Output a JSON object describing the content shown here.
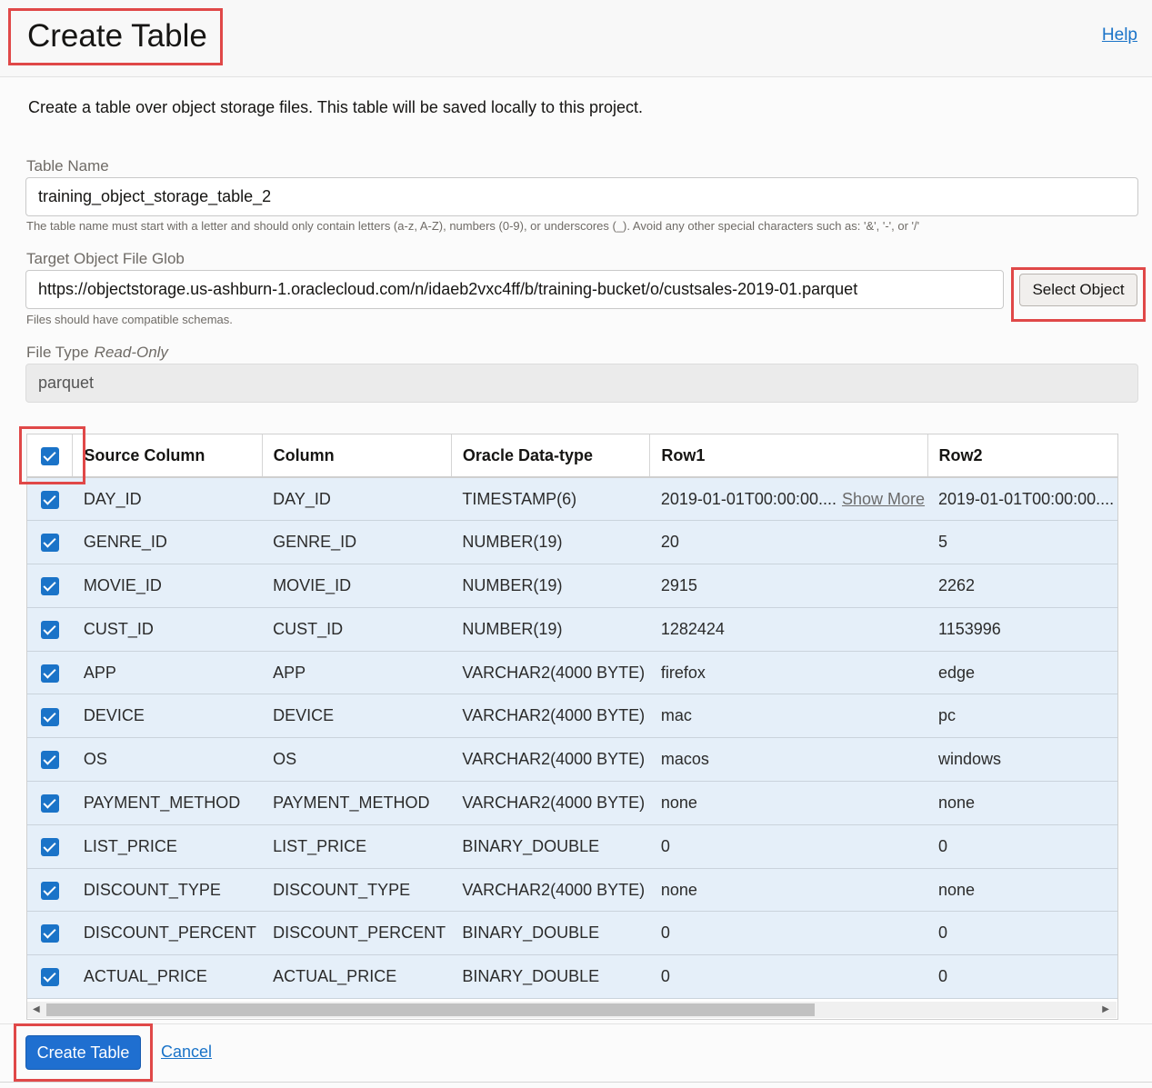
{
  "header": {
    "title": "Create Table",
    "help_link": "Help"
  },
  "description": "Create a table over object storage files. This table will be saved locally to this project.",
  "form": {
    "table_name_label": "Table Name",
    "table_name_value": "training_object_storage_table_2",
    "table_name_hint": "The table name must start with a letter and should only contain letters (a-z, A-Z), numbers (0-9), or underscores (_). Avoid any other special characters such as: '&', '-', or '/'",
    "glob_label": "Target Object File Glob",
    "glob_value": "https://objectstorage.us-ashburn-1.oraclecloud.com/n/idaeb2vxc4ff/b/training-bucket/o/custsales-2019-01.parquet",
    "glob_hint": "Files should have compatible schemas.",
    "select_object_button": "Select Object",
    "file_type_label": "File Type",
    "file_type_readonly": "Read-Only",
    "file_type_value": "parquet"
  },
  "table": {
    "headers": [
      "Source Column",
      "Column",
      "Oracle Data-type",
      "Row1",
      "Row2"
    ],
    "show_more": "Show More",
    "rows": [
      {
        "source": "DAY_ID",
        "column": "DAY_ID",
        "type": "TIMESTAMP(6)",
        "row1": "2019-01-01T00:00:00....",
        "row2": "2019-01-01T00:00:00...."
      },
      {
        "source": "GENRE_ID",
        "column": "GENRE_ID",
        "type": "NUMBER(19)",
        "row1": "20",
        "row2": "5"
      },
      {
        "source": "MOVIE_ID",
        "column": "MOVIE_ID",
        "type": "NUMBER(19)",
        "row1": "2915",
        "row2": "2262"
      },
      {
        "source": "CUST_ID",
        "column": "CUST_ID",
        "type": "NUMBER(19)",
        "row1": "1282424",
        "row2": "1153996"
      },
      {
        "source": "APP",
        "column": "APP",
        "type": "VARCHAR2(4000 BYTE)",
        "row1": "firefox",
        "row2": "edge"
      },
      {
        "source": "DEVICE",
        "column": "DEVICE",
        "type": "VARCHAR2(4000 BYTE)",
        "row1": "mac",
        "row2": "pc"
      },
      {
        "source": "OS",
        "column": "OS",
        "type": "VARCHAR2(4000 BYTE)",
        "row1": "macos",
        "row2": "windows"
      },
      {
        "source": "PAYMENT_METHOD",
        "column": "PAYMENT_METHOD",
        "type": "VARCHAR2(4000 BYTE)",
        "row1": "none",
        "row2": "none"
      },
      {
        "source": "LIST_PRICE",
        "column": "LIST_PRICE",
        "type": "BINARY_DOUBLE",
        "row1": "0",
        "row2": "0"
      },
      {
        "source": "DISCOUNT_TYPE",
        "column": "DISCOUNT_TYPE",
        "type": "VARCHAR2(4000 BYTE)",
        "row1": "none",
        "row2": "none"
      },
      {
        "source": "DISCOUNT_PERCENT",
        "column": "DISCOUNT_PERCENT",
        "type": "BINARY_DOUBLE",
        "row1": "0",
        "row2": "0"
      },
      {
        "source": "ACTUAL_PRICE",
        "column": "ACTUAL_PRICE",
        "type": "BINARY_DOUBLE",
        "row1": "0",
        "row2": "0"
      }
    ]
  },
  "footer": {
    "create_button": "Create Table",
    "cancel_link": "Cancel"
  },
  "colors": {
    "accent": "#1f6fd0",
    "row_bg": "#e5eff9",
    "highlight": "#e04848"
  }
}
